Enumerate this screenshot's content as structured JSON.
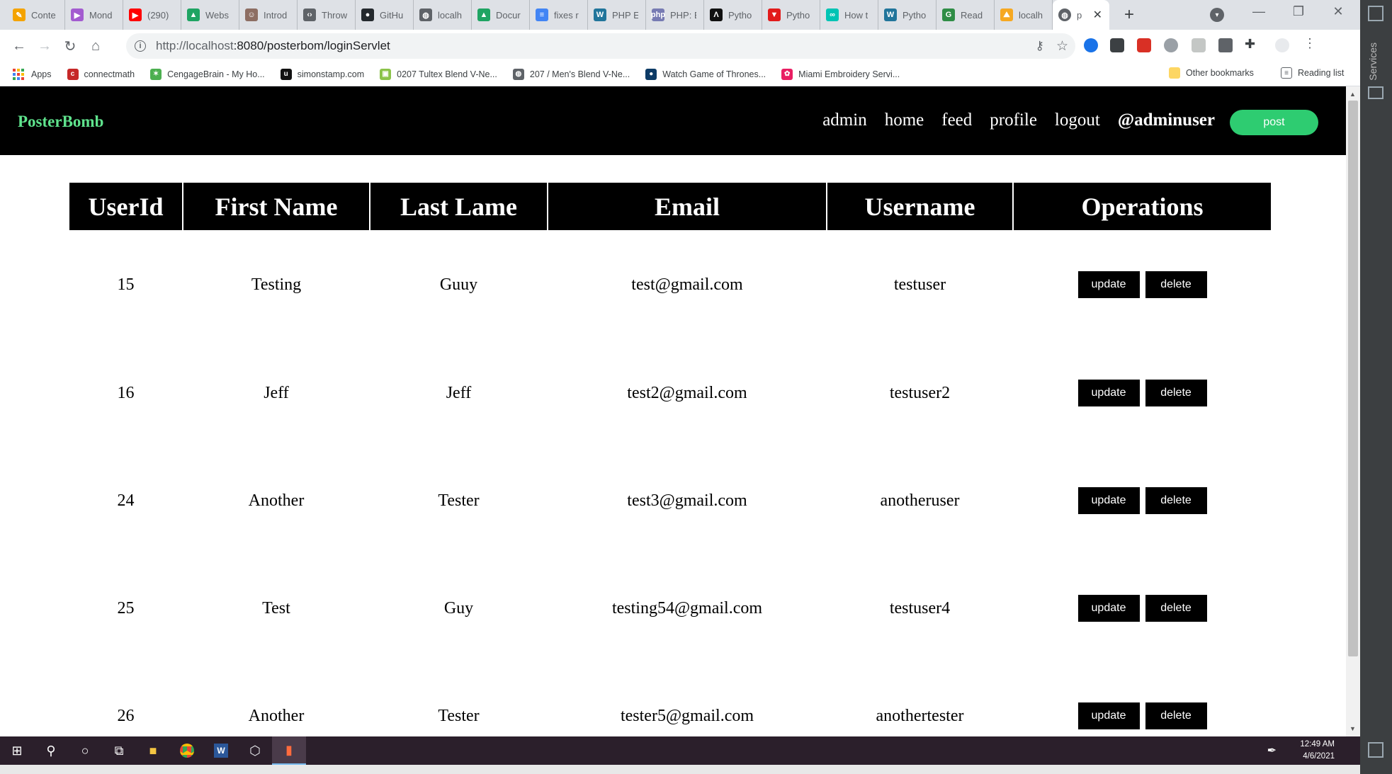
{
  "browser": {
    "tabs": [
      {
        "label": "Conte",
        "color": "#f4a300",
        "glyph": "✎"
      },
      {
        "label": "Mond",
        "color": "#a35bd0",
        "glyph": "▶"
      },
      {
        "label": "(290)",
        "color": "#ff0000",
        "glyph": "▶"
      },
      {
        "label": "Webs",
        "color": "#1fa463",
        "glyph": "▲"
      },
      {
        "label": "Introd",
        "color": "#8d6e63",
        "glyph": "☺"
      },
      {
        "label": "Throw",
        "color": "#5f6368",
        "glyph": "‹›"
      },
      {
        "label": "GitHu",
        "color": "#24292e",
        "glyph": "●"
      },
      {
        "label": "localh",
        "color": "#5f6368",
        "glyph": "◍"
      },
      {
        "label": "Docur",
        "color": "#1fa463",
        "glyph": "▲"
      },
      {
        "label": "fixes r",
        "color": "#4285f4",
        "glyph": "≡"
      },
      {
        "label": "PHP E",
        "color": "#21759b",
        "glyph": "W"
      },
      {
        "label": "PHP: E",
        "color": "#777bb3",
        "glyph": "php"
      },
      {
        "label": "Pytho",
        "color": "#111111",
        "glyph": "Λ"
      },
      {
        "label": "Pytho",
        "color": "#e21b1b",
        "glyph": "▼"
      },
      {
        "label": "How t",
        "color": "#00c4b4",
        "glyph": "∞"
      },
      {
        "label": "Pytho",
        "color": "#21759b",
        "glyph": "W"
      },
      {
        "label": "Read",
        "color": "#2f8d46",
        "glyph": "G"
      },
      {
        "label": "localh",
        "color": "#f6a821",
        "glyph": "⛰"
      }
    ],
    "active_tab": {
      "label": "p",
      "glyph": "◍"
    },
    "url_host": "http://localhost",
    "url_rest": ":8080/posterbom/loginServlet",
    "bookmarks": [
      {
        "label": "Apps"
      },
      {
        "label": "connectmath",
        "color": "#c62828",
        "glyph": "c"
      },
      {
        "label": "CengageBrain - My Ho...",
        "color": "#4caf50",
        "glyph": "✶"
      },
      {
        "label": "simonstamp.com",
        "color": "#111111",
        "glyph": "u"
      },
      {
        "label": "0207 Tultex Blend V-Ne...",
        "color": "#8bc34a",
        "glyph": "▣"
      },
      {
        "label": "207 / Men's Blend V-Ne...",
        "color": "#5f6368",
        "glyph": "◍"
      },
      {
        "label": "Watch Game of Thrones...",
        "color": "#0d3b66",
        "glyph": "●"
      },
      {
        "label": "Miami Embroidery Servi...",
        "color": "#e91e63",
        "glyph": "✿"
      }
    ],
    "other_bookmarks": "Other bookmarks",
    "reading_list": "Reading list"
  },
  "site": {
    "brand": "PosterBomb",
    "nav": [
      "admin",
      "home",
      "feed",
      "profile",
      "logout"
    ],
    "user_handle": "@adminuser",
    "post_button": "post"
  },
  "table": {
    "headers": [
      "UserId",
      "First Name",
      "Last Lame",
      "Email",
      "Username",
      "Operations"
    ],
    "rows": [
      {
        "id": "15",
        "first": "Testing",
        "last": "Guuy",
        "email": "test@gmail.com",
        "username": "testuser"
      },
      {
        "id": "16",
        "first": "Jeff",
        "last": "Jeff",
        "email": "test2@gmail.com",
        "username": "testuser2"
      },
      {
        "id": "24",
        "first": "Another",
        "last": "Tester",
        "email": "test3@gmail.com",
        "username": "anotheruser"
      },
      {
        "id": "25",
        "first": "Test",
        "last": "Guy",
        "email": "testing54@gmail.com",
        "username": "testuser4"
      },
      {
        "id": "26",
        "first": "Another",
        "last": "Tester",
        "email": "tester5@gmail.com",
        "username": "anothertester"
      }
    ],
    "update_label": "update",
    "delete_label": "delete"
  },
  "ide": {
    "services_label": "Services"
  },
  "taskbar": {
    "time": "12:49 AM",
    "date": "4/6/2021"
  },
  "colors": {
    "brand_green": "#5fe38d",
    "post_green": "#2ecc71",
    "nav_bg": "#000000"
  }
}
